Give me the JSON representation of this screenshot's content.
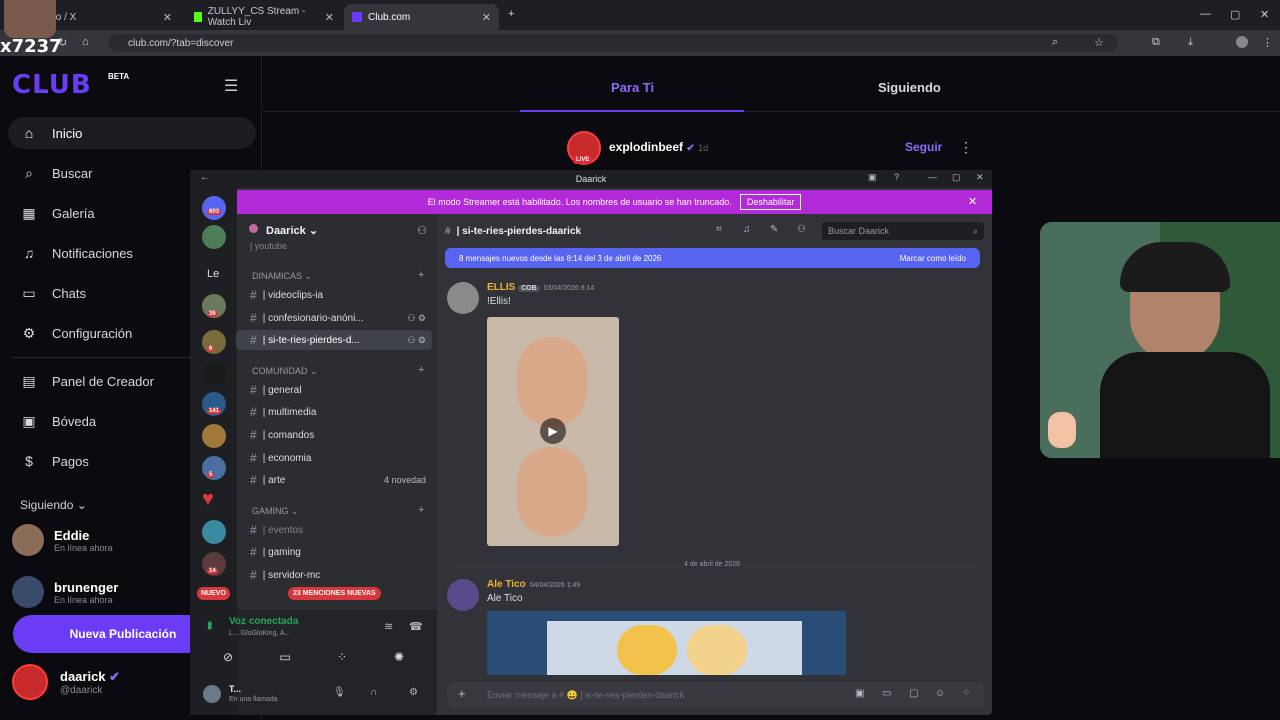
{
  "browser": {
    "tabs": [
      {
        "label": "Inicio / X"
      },
      {
        "label": "ZULLYY_CS Stream - Watch Liv"
      },
      {
        "label": "Club.com"
      }
    ],
    "url": "club.com/?tab=discover",
    "overlay_tag": "x7237"
  },
  "club": {
    "logo": "CLUB",
    "beta": "BETA",
    "nav": [
      {
        "label": "Inicio",
        "icon": "home-icon"
      },
      {
        "label": "Buscar",
        "icon": "search-icon"
      },
      {
        "label": "Galería",
        "icon": "gallery-icon"
      },
      {
        "label": "Notificaciones",
        "icon": "bell-icon"
      },
      {
        "label": "Chats",
        "icon": "chat-icon"
      },
      {
        "label": "Configuración",
        "icon": "gear-icon"
      },
      {
        "label": "Panel de Creador",
        "icon": "panel-icon"
      },
      {
        "label": "Bóveda",
        "icon": "vault-icon"
      },
      {
        "label": "Pagos",
        "icon": "dollar-icon"
      }
    ],
    "following_header": "Siguiendo",
    "following": [
      {
        "name": "Eddie",
        "status": "En línea ahora"
      },
      {
        "name": "brunenger",
        "status": "En línea ahora"
      }
    ],
    "new_post": "Nueva Publicación",
    "me": {
      "name": "daarick",
      "handle": "@daarick"
    }
  },
  "feed": {
    "tabs": [
      "Para Ti",
      "Siguiendo"
    ],
    "post": {
      "user": "explodinbeef",
      "time": "1d",
      "follow": "Seguir",
      "live": "LIVE"
    }
  },
  "discord": {
    "window_title": "Daarick",
    "banner": {
      "text": "El modo Streamer está habilitado. Los nombres de usuario se han truncado.",
      "button": "Deshabilitar"
    },
    "server_badges": [
      "603",
      "36",
      "6",
      "141",
      "5",
      "14"
    ],
    "left_label": "Le",
    "server_name": "Daarick",
    "channels_top": "| youtube",
    "categories": {
      "dinamicas": "DINAMICAS",
      "comunidad": "COMUNIDAD",
      "gaming": "GAMING"
    },
    "channels_dinamicas": [
      "| videoclips-ia",
      "| confesionario-anóni...",
      "| si-te-ries-pierdes-d..."
    ],
    "channels_comunidad": [
      "| general",
      "| multimedia",
      "| comandos",
      "| economia",
      "| arte"
    ],
    "arte_tag": "4 novedad",
    "channels_gaming": [
      "| eventos",
      "| gaming",
      "| servidor-mc"
    ],
    "mentions": "23 MENCIONES NUEVAS",
    "nuevo": "NUEVO",
    "voice": {
      "title": "Voz conectada",
      "sub": "L... GloGloKing, A..."
    },
    "me": {
      "name": "T...",
      "status": "En una llamada"
    },
    "chat": {
      "channel": "| si-te-ries-pierdes-daarick",
      "search": "Buscar Daarick",
      "new_msgs": "8 mensajes nuevos desde las 8:14 del 3 de abril de 2026",
      "mark_read": "Marcar como leído",
      "messages": [
        {
          "name": "ELLIS",
          "tag": "COB",
          "date": "03/04/2026 8:14",
          "text": "!Ellis!",
          "color": "#f0b232"
        },
        {
          "name": "Ale Tico",
          "date": "04/04/2026 1:49",
          "text": "Ale Tico",
          "color": "#f0b232"
        }
      ],
      "divider": "4 de abril de 2026",
      "composer": "Enviar mensaje a # 😀 | si-te-ries-pierdes-daarick"
    }
  },
  "colors": {
    "accent": "#6b3cf5",
    "discord_banner": "#b32bd8",
    "discord_blurple": "#5865f2"
  }
}
